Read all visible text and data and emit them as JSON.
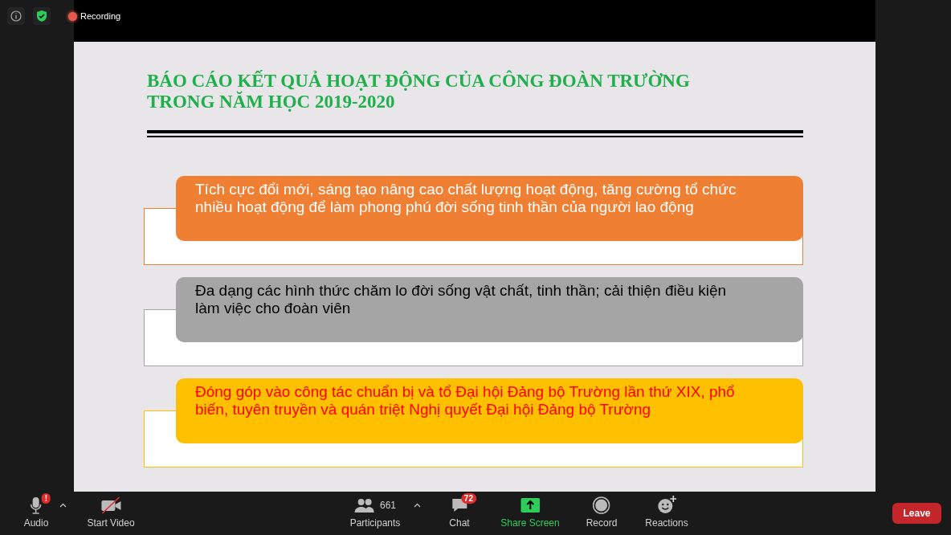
{
  "top_bar": {
    "recording_label": "Recording"
  },
  "slide": {
    "title_lines": [
      "BÁO CÁO KẾT QUẢ HOẠT ĐỘNG CỦA CÔNG ĐOÀN TRƯỜNG",
      "TRONG NĂM HỌC 2019-2020"
    ],
    "cards": [
      {
        "text": "Tích cực đổi mới, sáng tạo nâng cao chất lượng hoạt động, tăng cường tổ chức nhiều hoạt động để làm phong phú đời sống tinh thần của người lao động",
        "color": "#ef7f33",
        "kind": "inverse"
      },
      {
        "text": "Đa dạng các hình thức chăm lo đời sống vật chất, tinh thần; cải thiện điều kiện làm việc cho đoàn viên",
        "color": "#a5a5a5",
        "kind": "plain"
      },
      {
        "text": "Đóng góp vào công tác chuẩn bị và tổ Đại hội Đảng bộ Trường lần thứ XIX, phổ biến, tuyên truyền và quán triệt Nghị quyết Đại hội Đảng bộ Trường",
        "color": "#ffc000",
        "kind": "alert"
      }
    ]
  },
  "toolbar": {
    "items": [
      {
        "kind": "audio",
        "label": "Audio",
        "badge": "!"
      },
      {
        "kind": "video",
        "label": "Start Video"
      },
      {
        "kind": "participants",
        "label": "Participants",
        "count": "661"
      },
      {
        "kind": "chat",
        "label": "Chat",
        "badge": "72"
      },
      {
        "kind": "share",
        "label": "Share Screen"
      },
      {
        "kind": "record",
        "label": "Record"
      },
      {
        "kind": "reactions",
        "label": "Reactions"
      }
    ],
    "leave_label": "Leave"
  }
}
